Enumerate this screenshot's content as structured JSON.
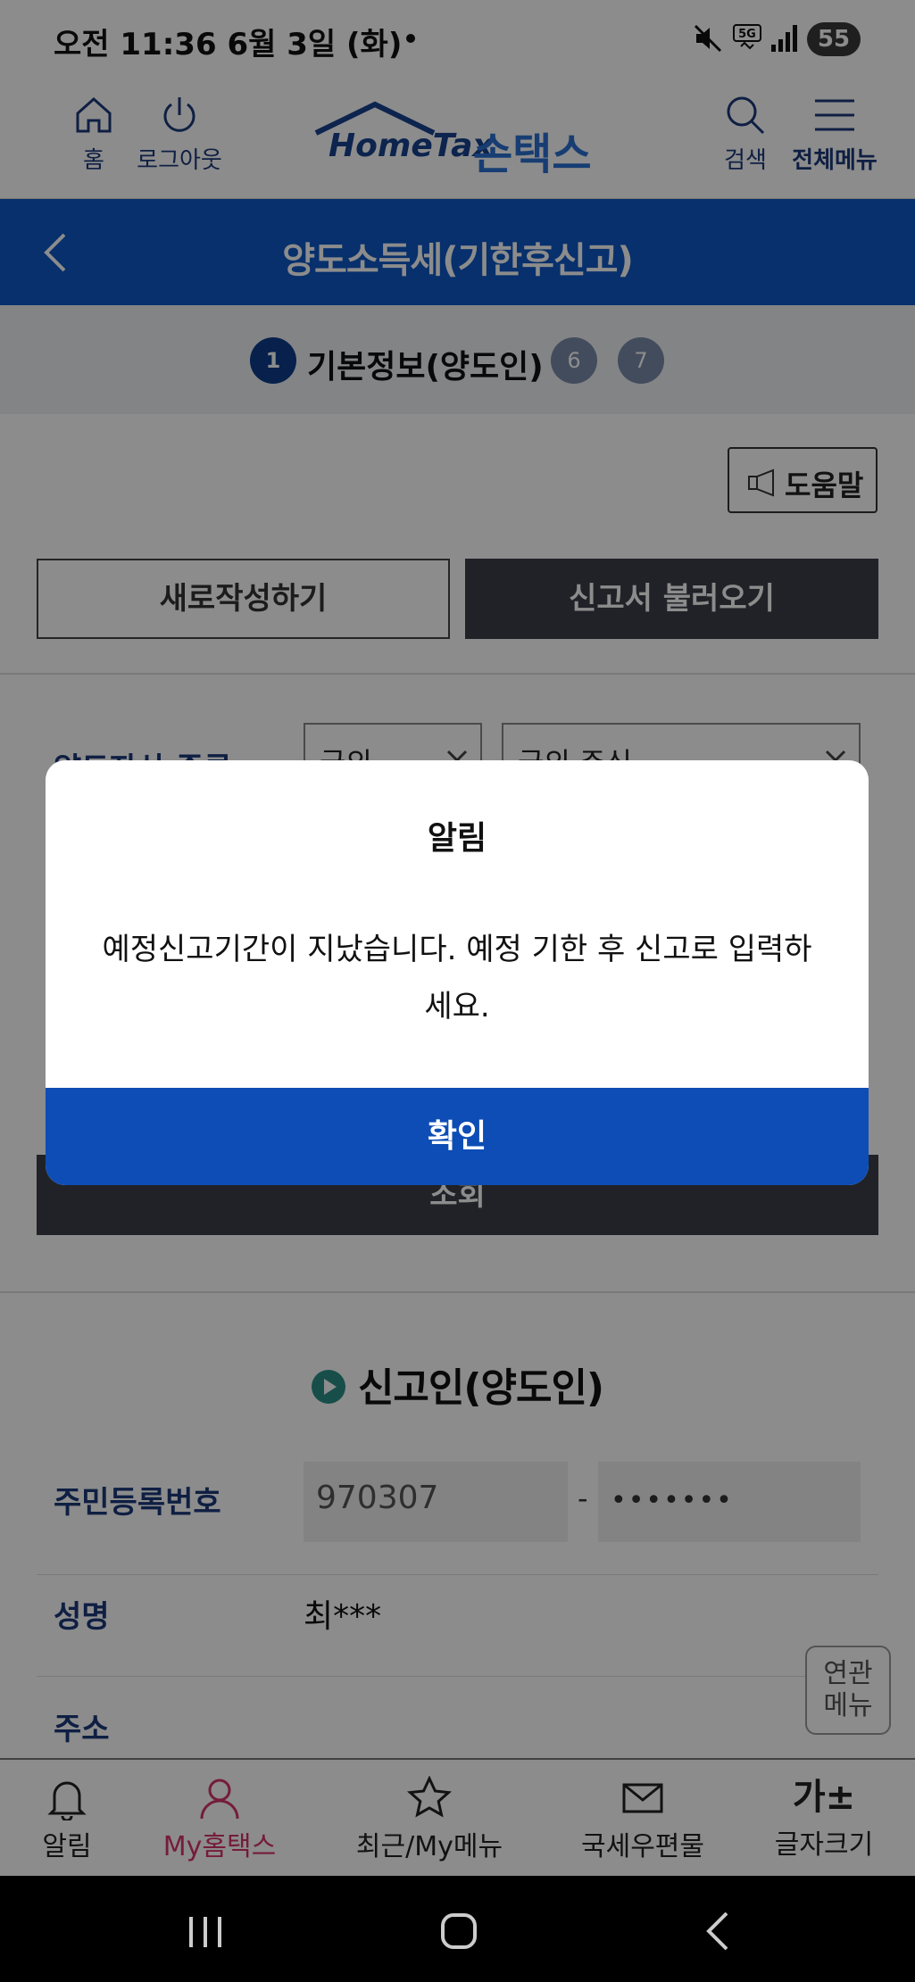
{
  "status_bar": {
    "time": "오전 11:36  6월 3일 (화)",
    "battery": "55",
    "icons": [
      "mute-icon",
      "5g-icon",
      "signal-icon",
      "battery-icon"
    ]
  },
  "header": {
    "home_label": "홈",
    "logout_label": "로그아웃",
    "logo_en": "HomeTax",
    "logo_ko": "손택스",
    "search_label": "검색",
    "menu_label": "전체메뉴"
  },
  "titlebar": {
    "title": "양도소득세(기한후신고)"
  },
  "steps": {
    "step1_number": "1",
    "step1_label": "기본정보(양도인)",
    "step6_number": "6",
    "step7_number": "7"
  },
  "content": {
    "help_label": "도움말",
    "new_button": "새로작성하기",
    "load_button": "신고서 불러오기",
    "asset_type_label": "양도자산 종류",
    "asset_type_select1": "국외",
    "asset_type_select2": "국외 주식",
    "query_button": "조회",
    "section_title": "신고인(양도인)",
    "rrn_label": "주민등록번호",
    "rrn_front": "970307",
    "rrn_dash": "-",
    "rrn_back": "•••••••",
    "name_label": "성명",
    "name_value": "최***",
    "address_label": "주소",
    "related_menu": "연관 메뉴"
  },
  "bottom_nav": {
    "items": [
      {
        "label": "알림",
        "icon": "bell-icon"
      },
      {
        "label": "My홈택스",
        "icon": "person-icon"
      },
      {
        "label": "최근/My메뉴",
        "icon": "star-icon"
      },
      {
        "label": "국세우편물",
        "icon": "mail-icon"
      },
      {
        "label": "글자크기",
        "icon": "font-size-icon",
        "glyph": "가±"
      }
    ],
    "active_color": "#d6336c"
  },
  "dialog": {
    "title": "알림",
    "message": "예정신고기간이 지났습니다. 예정 기한 후 신고로 입력하세요.",
    "confirm_button": "확인"
  },
  "colors": {
    "brand_blue": "#0d58c5",
    "dialog_button": "#0d4db5",
    "dark_button": "#3c3f4a"
  }
}
